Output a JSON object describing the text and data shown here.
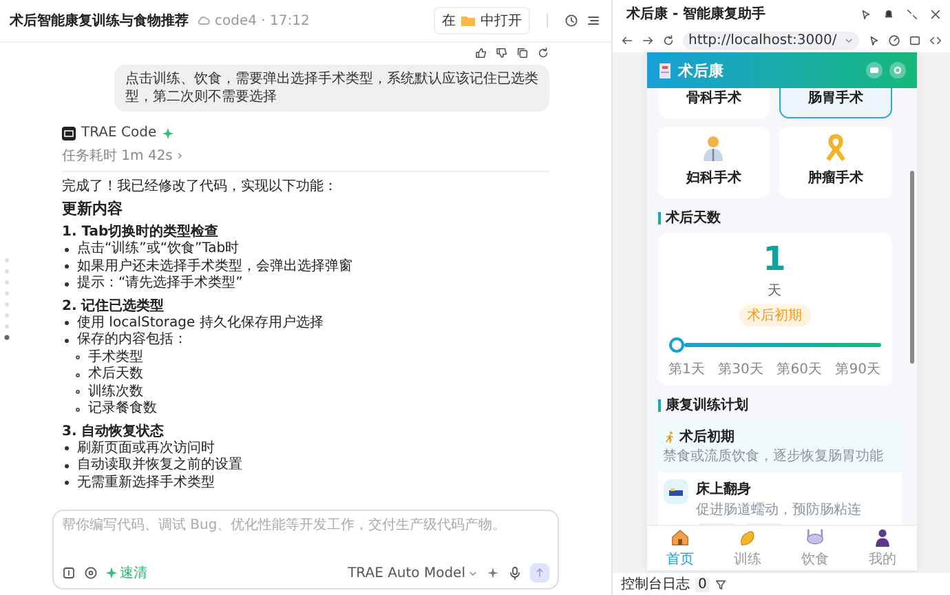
{
  "chat": {
    "title": "术后智能康复训练与食物推荐",
    "meta": "code4 · 17:12",
    "open_in": {
      "before": "在",
      "after": "中打开"
    },
    "user_message": "点击训练、饮食，需要弹出选择手术类型，系统默认应该记住已选类型，第二次则不需要选择",
    "agent": {
      "name": "TRAE Code",
      "duration": "任务耗时 1m 42s ›"
    },
    "reply": {
      "intro": "完成了！我已经修改了代码，实现以下功能：",
      "heading": "更新内容",
      "sections": [
        {
          "title": "1. Tab切换时的类型检查",
          "items": [
            {
              "text": "点击“训练”或“饮食”Tab时"
            },
            {
              "text": "如果用户还未选择手术类型，会弹出选择弹窗"
            },
            {
              "text": "提示：“请先选择手术类型”"
            }
          ]
        },
        {
          "title": "2. 记住已选类型",
          "items": [
            {
              "text": "使用 localStorage 持久化保存用户选择"
            },
            {
              "text": "保存的内容包括：",
              "children": [
                {
                  "text": "手术类型"
                },
                {
                  "text": "术后天数"
                },
                {
                  "text": "训练次数"
                },
                {
                  "text": "记录餐食数"
                }
              ]
            }
          ]
        },
        {
          "title": "3. 自动恢复状态",
          "items": [
            {
              "text": "刷新页面或再次访问时"
            },
            {
              "text": "自动读取并恢复之前的设置"
            },
            {
              "text": "无需重新选择手术类型"
            }
          ]
        }
      ]
    }
  },
  "composer": {
    "placeholder": "帮你编写代码、调试 Bug、优化性能等开发工作，交付生产级代码产物。",
    "mode": "速清",
    "model": "TRAE Auto Model"
  },
  "browser": {
    "title": "术后康 - 智能康复助手",
    "url": "http://localhost:3000/",
    "app": {
      "name": "术后康",
      "surgery_types": [
        {
          "label": "骨科手术",
          "selected": false
        },
        {
          "label": "肠胃手术",
          "selected": true
        },
        {
          "label": "妇科手术",
          "selected": false
        },
        {
          "label": "肿瘤手术",
          "selected": false
        }
      ],
      "days_section": "术后天数",
      "days": {
        "value": "1",
        "unit": "天",
        "stage": "术后初期",
        "level": 0,
        "ticks": [
          "第1天",
          "第30天",
          "第60天",
          "第90天"
        ]
      },
      "plan_section": "康复训练计划",
      "plan": {
        "stage": "术后初期",
        "note": "禁食或流质饮食，逐步恢复肠胃功能",
        "exercises": [
          {
            "name": "床上翻身",
            "desc": "促进肠道蠕动，预防肠粘连"
          }
        ]
      },
      "nav": [
        {
          "label": "首页",
          "selected": true
        },
        {
          "label": "训练",
          "selected": false
        },
        {
          "label": "饮食",
          "selected": false
        },
        {
          "label": "我的",
          "selected": false
        }
      ]
    },
    "console": {
      "label": "控制台日志",
      "count": "0"
    }
  }
}
